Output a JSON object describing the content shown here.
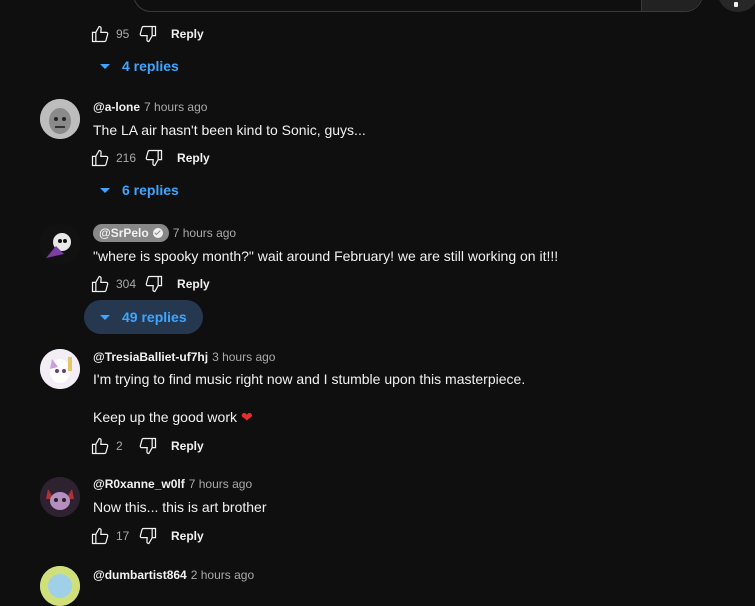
{
  "top_row": {
    "likes": "95",
    "reply_label": "Reply",
    "replies_label": "4 replies"
  },
  "comments": [
    {
      "author": "@a-lone",
      "time": "7 hours ago",
      "text": "The LA air hasn't been kind to Sonic, guys...",
      "likes": "216",
      "reply_label": "Reply",
      "replies_label": "6 replies"
    },
    {
      "author": "@SrPelo",
      "verified": true,
      "time": "7 hours ago",
      "text": "\"where is spooky month?\" wait around February! we are still working on it!!!",
      "likes": "304",
      "reply_label": "Reply",
      "replies_label": "49 replies"
    },
    {
      "author": "@TresiaBalliet-uf7hj",
      "time": "3 hours ago",
      "text_line1": "I'm trying to find music right now and I stumble upon this masterpiece.",
      "text_line2": "Keep up the good work",
      "likes": "2",
      "reply_label": "Reply"
    },
    {
      "author": "@R0xanne_w0lf",
      "time": "7 hours ago",
      "text": "Now this... this is art brother",
      "likes": "17",
      "reply_label": "Reply"
    },
    {
      "author": "@dumbartist864",
      "time": "2 hours ago"
    }
  ],
  "colors": {
    "background": "#0f0f0f",
    "link": "#3ea6ff",
    "meta": "#aaaaaa",
    "heart": "#e62e2e"
  }
}
